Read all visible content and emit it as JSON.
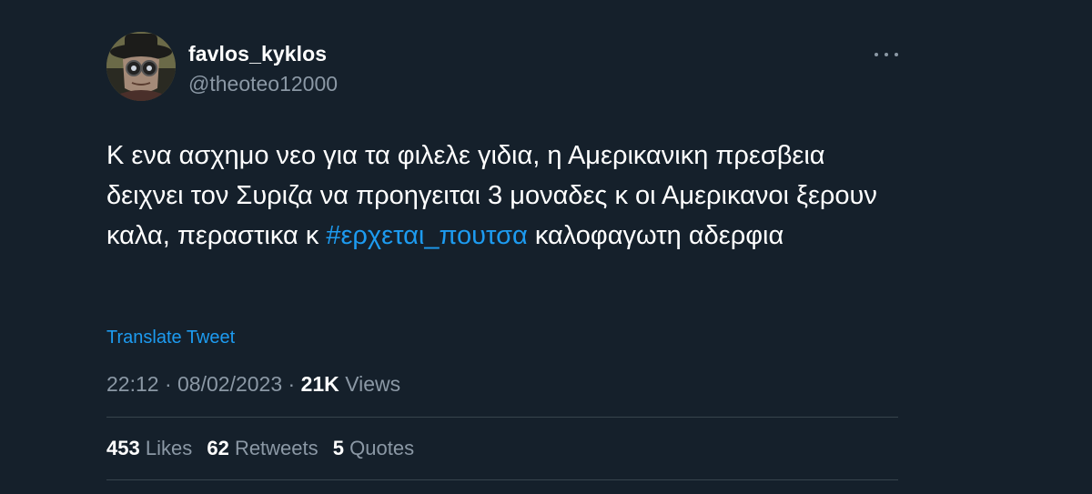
{
  "author": {
    "display_name": "favlos_kyklos",
    "handle": "@theoteo12000"
  },
  "tweet": {
    "text_before": "Κ ενα ασχημο νεο για τα φιλελε γιδια, η Αμερικανικη πρεσβεια δειχνει τον Συριζα να προηγειται 3 μοναδες κ οι Αμερικανοι ξερουν καλα, περαστικα κ ",
    "hashtag": "#ερχεται_πουτσα",
    "text_after": " καλοφαγωτη αδερφια"
  },
  "translate_label": "Translate Tweet",
  "meta": {
    "time": "22:12",
    "separator": "·",
    "date": "08/02/2023",
    "views_count": "21K",
    "views_label": "Views"
  },
  "stats": {
    "likes_count": "453",
    "likes_label": "Likes",
    "retweets_count": "62",
    "retweets_label": "Retweets",
    "quotes_count": "5",
    "quotes_label": "Quotes"
  },
  "icons": {
    "more": "more-horizontal-icon"
  },
  "colors": {
    "background": "#15202b",
    "accent": "#1d9bf0",
    "secondary_text": "#8b98a5",
    "divider": "#38444d"
  }
}
